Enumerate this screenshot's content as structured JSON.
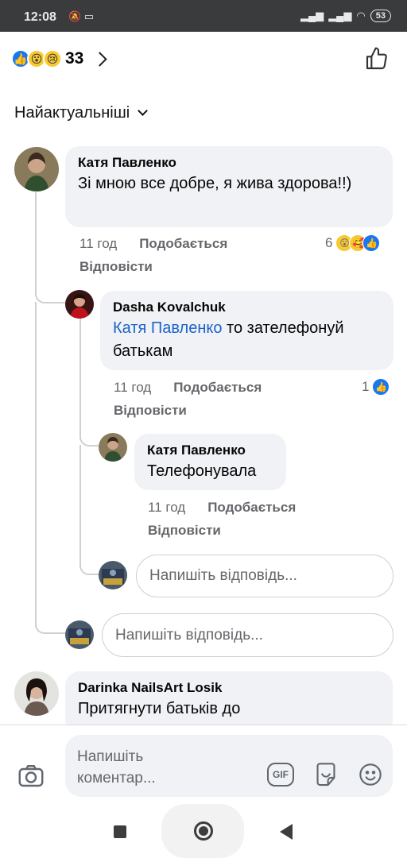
{
  "status_bar": {
    "time": "12:08",
    "battery": "53"
  },
  "reactions_header": {
    "count": "33",
    "emojis": [
      "like",
      "wow",
      "sad"
    ]
  },
  "sort": {
    "label": "Найактуальніші"
  },
  "comments": [
    {
      "author": "Катя Павленко",
      "text": "Зі мною все добре, я жива здорова!!)",
      "time": "11 год",
      "like_label": "Подобається",
      "reply_label": "Відповісти",
      "reaction_count": "6",
      "reaction_emojis": [
        "wow",
        "care",
        "like"
      ]
    },
    {
      "author": "Dasha Kovalchuk",
      "mention": "Катя Павленко",
      "text": "то зателефонуй батькам",
      "time": "11 год",
      "like_label": "Подобається",
      "reply_label": "Відповісти",
      "reaction_count": "1",
      "reaction_emojis": [
        "like"
      ]
    },
    {
      "author": "Катя Павленко",
      "text": "Телефонувала",
      "time": "11 год",
      "like_label": "Подобається",
      "reply_label": "Відповісти"
    },
    {
      "author": "Darinka NailsArt Losik",
      "text": "Притягнути батьків до"
    }
  ],
  "reply_inputs": {
    "placeholder": "Напишіть відповідь..."
  },
  "composer": {
    "placeholder_line1": "Напишіть",
    "placeholder_line2": "коментар...",
    "gif_label": "GIF"
  },
  "colors": {
    "accent": "#1877f2",
    "mention": "#1d63c9",
    "bubble": "#f0f2f5",
    "secondary_text": "#65676b"
  }
}
